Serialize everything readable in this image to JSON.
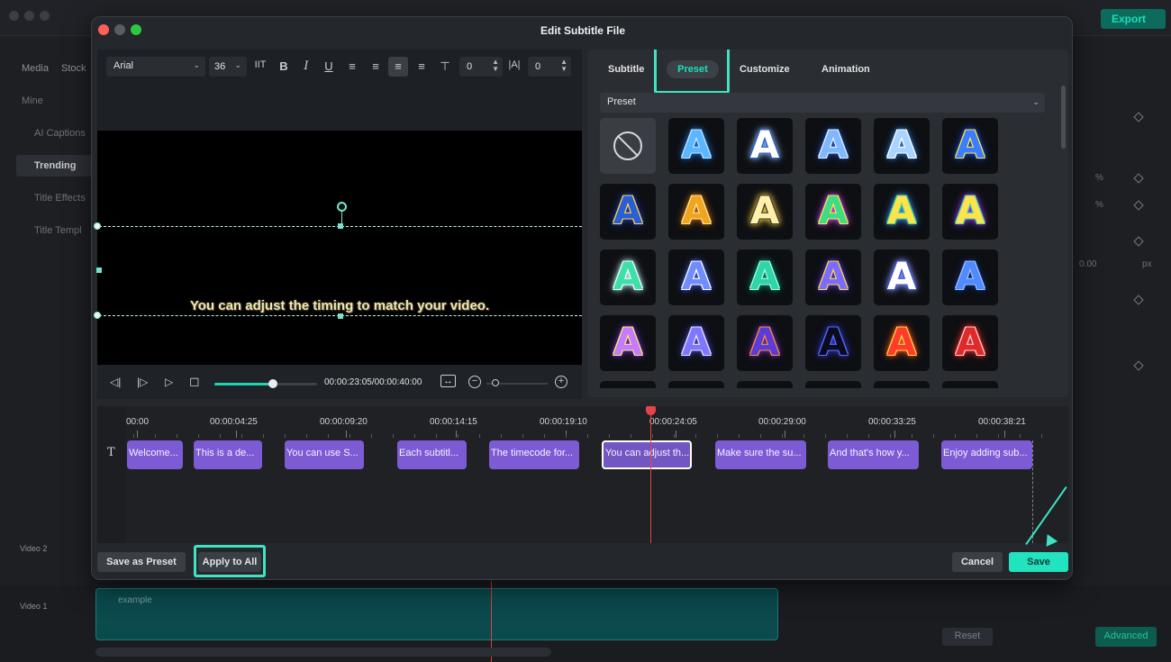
{
  "background": {
    "export_label": "Export",
    "left_tabs": [
      "Media",
      "Stock"
    ],
    "left_items": [
      "Mine",
      "AI Captions",
      "Trending",
      "Title Effects",
      "Title Templ"
    ],
    "right_values": [
      "%",
      "%",
      "0.00",
      "px"
    ],
    "track_labels": [
      "Video 2",
      "Video 1"
    ],
    "clip_label": "example",
    "reset_label": "Reset",
    "advanced_label": "Advanced"
  },
  "dialog": {
    "title": "Edit Subtitle File",
    "toolbar": {
      "font": "Arial",
      "size": "36",
      "char_spacing": "0",
      "line_spacing": "0"
    },
    "preview": {
      "subtitle_text": "You can adjust the timing to match your video."
    },
    "playback": {
      "timecode": "00:00:23:05/00:00:40:00",
      "progress": 0.57
    },
    "tabs": [
      {
        "label": "Subtitle"
      },
      {
        "label": "Preset"
      },
      {
        "label": "Customize"
      },
      {
        "label": "Animation"
      }
    ],
    "active_tab": "Preset",
    "preset_dropdown": "Preset",
    "preset_tiles": [
      {
        "style": "none"
      },
      {
        "fill": "#5ab6ff",
        "stroke": "#bfe6ff",
        "glow": "#1b6fd6"
      },
      {
        "fill": "#ffffff",
        "stroke": "#2a5dbf",
        "glow": "#8ab6ff"
      },
      {
        "fill": "#7fb8ff",
        "stroke": "#e8f1ff",
        "glow": "#1c4fb2"
      },
      {
        "fill": "#a8d4ff",
        "stroke": "#ffffff",
        "glow": "#2e79d9"
      },
      {
        "fill": "#3a7dff",
        "stroke": "#ffe34c",
        "glow": "#1a4ed8"
      },
      {
        "fill": "#2a5dd8",
        "stroke": "#ffd54a",
        "glow": "#1a3db8"
      },
      {
        "fill": "#f0a51e",
        "stroke": "#ffe4a0",
        "glow": "#c46a0e"
      },
      {
        "fill": "#fff1a8",
        "stroke": "#3b3b3b",
        "glow": "#ffd23b"
      },
      {
        "fill": "#3fdc85",
        "stroke": "#ffe34c",
        "glow": "#d44aff"
      },
      {
        "fill": "#ffe34c",
        "stroke": "#3fdc85",
        "glow": "#4a8cff"
      },
      {
        "fill": "#ffe34c",
        "stroke": "#4fd9a5",
        "glow": "#9b3cff"
      },
      {
        "fill": "#3fe0a8",
        "stroke": "#e8fff6",
        "glow": "#c4f0ff"
      },
      {
        "fill": "#6f8dff",
        "stroke": "#ffffff",
        "glow": "#3e55c9"
      },
      {
        "fill": "#2fd4a8",
        "stroke": "#a2ffe6",
        "glow": "#0f8a6a"
      },
      {
        "fill": "#7a6cff",
        "stroke": "#ffd84a",
        "glow": "#5436d1"
      },
      {
        "fill": "#ffffff",
        "stroke": "#3b4fd8",
        "glow": "#8a9aff"
      },
      {
        "fill": "#4f8aff",
        "stroke": "#9ec2ff",
        "glow": "#15307a"
      },
      {
        "fill": "#c47bff",
        "stroke": "#ffeb6a",
        "glow": "#6a2fd0"
      },
      {
        "fill": "#7f78ff",
        "stroke": "#e7e4ff",
        "glow": "#4840c8"
      },
      {
        "fill": "#5a3cd8",
        "stroke": "#ff8a3c",
        "glow": "#6a2fa8"
      },
      {
        "fill": "#0b0b1e",
        "stroke": "#5a6cff",
        "glow": "#2b36c8"
      },
      {
        "fill": "#ff3b2a",
        "stroke": "#ffd24a",
        "glow": "#ff5a1e"
      },
      {
        "fill": "#e02a2a",
        "stroke": "#ffd0d0",
        "glow": "#ff2a2a"
      }
    ],
    "preset_letter": "A",
    "ruler": [
      "00:00",
      "00:00:04:25",
      "00:00:09:20",
      "00:00:14:15",
      "00:00:19:10",
      "00:00:24:05",
      "00:00:29:00",
      "00:00:33:25",
      "00:00:38:21"
    ],
    "clips": [
      {
        "label": "Welcome..."
      },
      {
        "label": "This is a de..."
      },
      {
        "label": "You can use S..."
      },
      {
        "label": "Each subtitl..."
      },
      {
        "label": "The timecode for..."
      },
      {
        "label": "You can adjust th..."
      },
      {
        "label": "Make sure the su..."
      },
      {
        "label": "And that's how y..."
      },
      {
        "label": "Enjoy adding sub..."
      }
    ],
    "selected_clip": "You can adjust th...",
    "footer": {
      "save_preset": "Save as Preset",
      "apply_all": "Apply to All",
      "cancel": "Cancel",
      "save": "Save"
    }
  },
  "colors": {
    "accent": "#21e3bf",
    "clip": "#7d5bd4",
    "playhead": "#e9434a"
  }
}
